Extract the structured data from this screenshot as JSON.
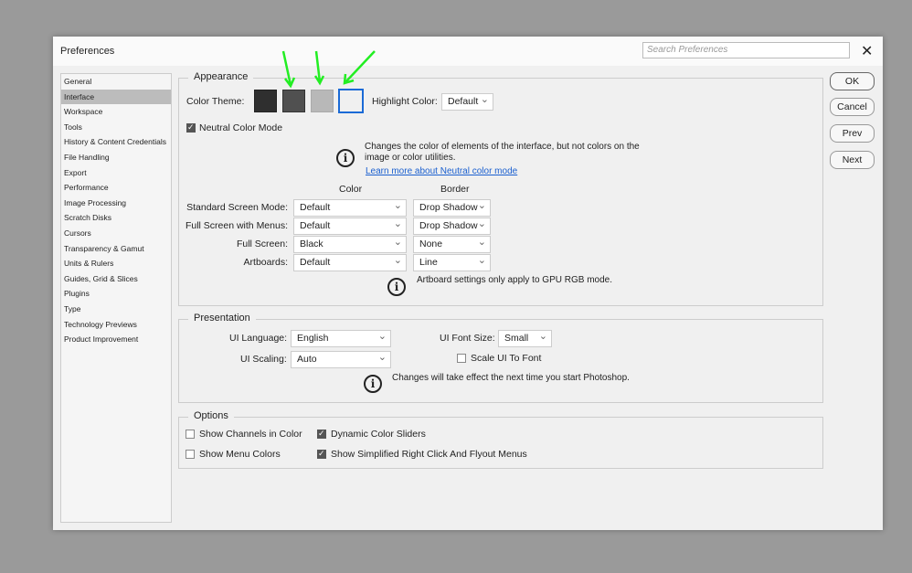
{
  "dialog": {
    "title": "Preferences",
    "search_placeholder": "Search Preferences",
    "close": "✕"
  },
  "sidebar": {
    "items": [
      "General",
      "Interface",
      "Workspace",
      "Tools",
      "History & Content Credentials",
      "File Handling",
      "Export",
      "Performance",
      "Image Processing",
      "Scratch Disks",
      "Cursors",
      "Transparency & Gamut",
      "Units & Rulers",
      "Guides, Grid & Slices",
      "Plugins",
      "Type",
      "Technology Previews",
      "Product Improvement"
    ],
    "selected": "Interface"
  },
  "appearance": {
    "legend": "Appearance",
    "color_theme_label": "Color Theme:",
    "themes": [
      "#2f2f2f",
      "#505050",
      "#b8b8b8",
      "#f0f0f0"
    ],
    "selected_theme": 3,
    "highlight_label": "Highlight Color:",
    "highlight_value": "Default",
    "neutral_label": "Neutral Color Mode",
    "neutral_checked": true,
    "neutral_info": "Changes the color of elements of the interface, but not colors on the",
    "neutral_info2": "image or color utilities.",
    "neutral_link": "Learn more about Neutral color mode",
    "col_color": "Color",
    "col_border": "Border",
    "rows": [
      {
        "label": "Standard Screen Mode:",
        "color": "Default",
        "border": "Drop Shadow"
      },
      {
        "label": "Full Screen with Menus:",
        "color": "Default",
        "border": "Drop Shadow"
      },
      {
        "label": "Full Screen:",
        "color": "Black",
        "border": "None"
      },
      {
        "label": "Artboards:",
        "color": "Default",
        "border": "Line"
      }
    ],
    "artboard_info": "Artboard settings only apply to GPU RGB mode."
  },
  "presentation": {
    "legend": "Presentation",
    "lang_label": "UI Language:",
    "lang": "English",
    "font_label": "UI Font Size:",
    "font": "Small",
    "scaling_label": "UI Scaling:",
    "scaling": "Auto",
    "scale_font_label": "Scale UI To Font",
    "info": "Changes will take effect the next time you start Photoshop."
  },
  "options": {
    "legend": "Options",
    "channels": "Show Channels in Color",
    "menu_colors": "Show Menu Colors",
    "dynamic": "Dynamic Color Sliders",
    "simplified": "Show Simplified Right Click And Flyout Menus"
  },
  "buttons": {
    "ok": "OK",
    "cancel": "Cancel",
    "prev": "Prev",
    "next": "Next"
  },
  "annotation_color": "#22ee22"
}
